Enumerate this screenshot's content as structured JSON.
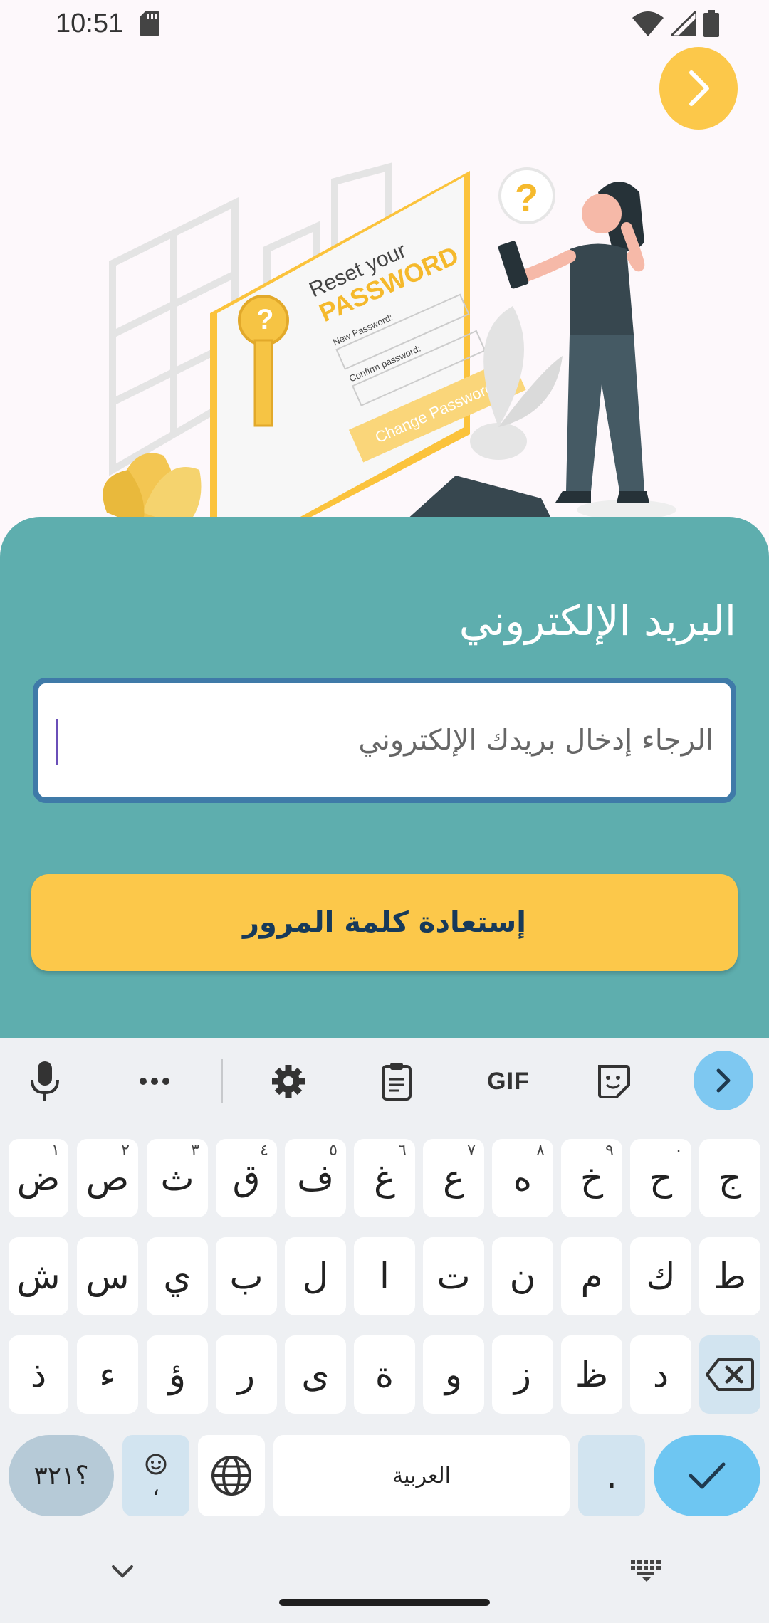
{
  "status": {
    "time": "10:51"
  },
  "illustration": {
    "title_line1": "Reset your",
    "title_line2": "PASSWORD",
    "new_password_label": "New Password:",
    "confirm_password_label": "Confirm password:",
    "change_password_button": "Change Password",
    "question_mark": "?"
  },
  "form": {
    "email_label": "البريد الإلكتروني",
    "email_placeholder": "الرجاء إدخال بريدك الإلكتروني",
    "email_value": "",
    "restore_button": "إستعادة كلمة المرور"
  },
  "keyboard": {
    "toolbar": {
      "gif_label": "GIF"
    },
    "row1": [
      {
        "char": "ض",
        "hint": "١"
      },
      {
        "char": "ص",
        "hint": "٢"
      },
      {
        "char": "ث",
        "hint": "٣"
      },
      {
        "char": "ق",
        "hint": "٤"
      },
      {
        "char": "ف",
        "hint": "٥"
      },
      {
        "char": "غ",
        "hint": "٦"
      },
      {
        "char": "ع",
        "hint": "٧"
      },
      {
        "char": "ه",
        "hint": "٨"
      },
      {
        "char": "خ",
        "hint": "٩"
      },
      {
        "char": "ح",
        "hint": "٠"
      },
      {
        "char": "ج",
        "hint": ""
      }
    ],
    "row2": [
      "ش",
      "س",
      "ي",
      "ب",
      "ل",
      "ا",
      "ت",
      "ن",
      "م",
      "ك",
      "ط"
    ],
    "row3": [
      "ذ",
      "ء",
      "ؤ",
      "ر",
      "ى",
      "ة",
      "و",
      "ز",
      "ظ",
      "د"
    ],
    "bottom": {
      "numbers_label": "؟٣٢١",
      "comma_label": "،",
      "space_label": "العربية",
      "period_label": "."
    }
  },
  "colors": {
    "accent_yellow": "#fcc84a",
    "sheet_teal": "#5eaeae",
    "field_border": "#3f7aa8",
    "button_text": "#173a5a"
  }
}
